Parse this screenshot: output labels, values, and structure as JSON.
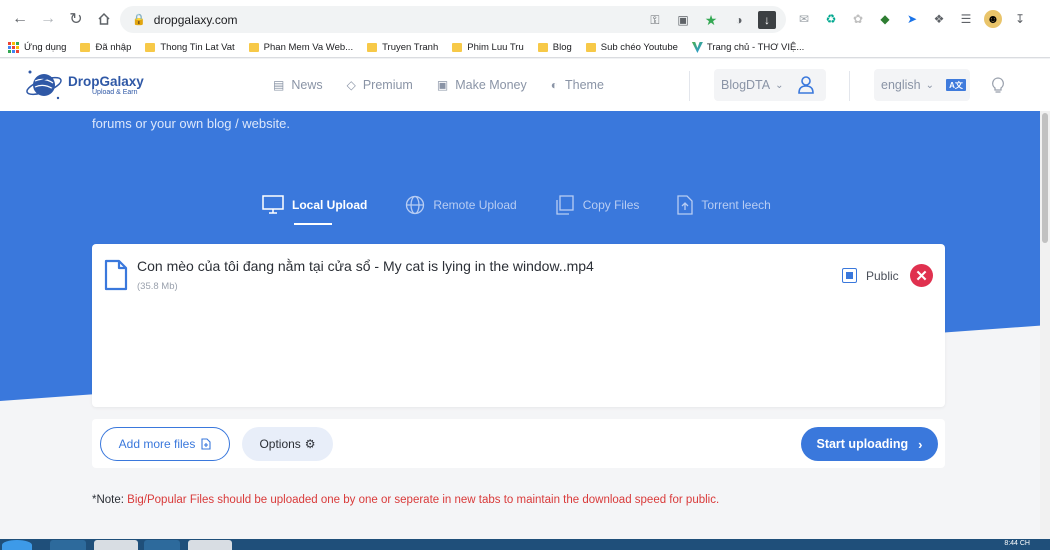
{
  "browser": {
    "url": "dropgalaxy.com",
    "bookmarks": [
      "Ứng dụng",
      "Đã nhập",
      "Thong Tin Lat Vat",
      "Phan Mem Va Web...",
      "Truyen Tranh",
      "Phim Luu Tru",
      "Blog",
      "Sub chéo Youtube",
      "Trang chủ - THƠ VIỆ..."
    ]
  },
  "site": {
    "logo_title": "DropGalaxy",
    "logo_subtitle": "Upload & Earn",
    "nav": [
      "News",
      "Premium",
      "Make Money",
      "Theme"
    ],
    "account_label": "BlogDTA",
    "language_label": "english",
    "language_badge": "A文"
  },
  "hero": {
    "text": "forums or your own blog / website."
  },
  "tabs": [
    "Local Upload",
    "Remote Upload",
    "Copy Files",
    "Torrent leech"
  ],
  "active_tab": "Local Upload",
  "file": {
    "name": "Con mèo của tôi đang nằm tại cửa sổ - My cat is lying in the window..mp4",
    "size": "(35.8 Mb)",
    "public_label": "Public",
    "public_checked": true
  },
  "actions": {
    "add_more_label": "Add more files",
    "options_label": "Options",
    "start_label": "Start uploading"
  },
  "note": {
    "prefix": "*Note:",
    "text": " Big/Popular Files should be uploaded one by one or seperate in new tabs to maintain the download speed for public."
  },
  "taskbar": {
    "clock": "8:44 CH"
  },
  "colors": {
    "brand_blue": "#3a78dc",
    "danger_red": "#e0314f",
    "note_red": "#d93a3a"
  }
}
